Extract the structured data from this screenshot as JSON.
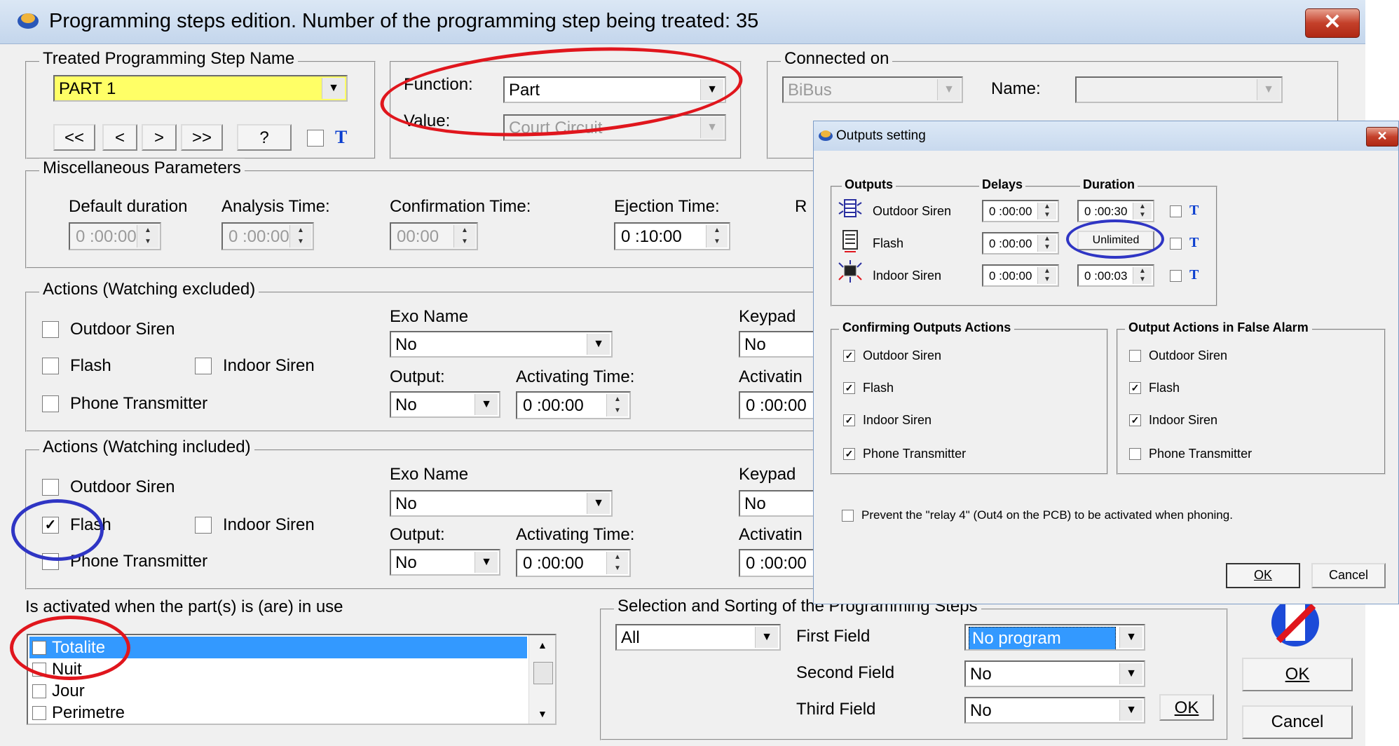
{
  "window": {
    "title": "Programming steps edition.  Number of the programming step being treated: 35",
    "close_label": "✕"
  },
  "step_name_group": {
    "legend": "Treated Programming Step Name",
    "name_value": "PART 1",
    "nav_first": "<<",
    "nav_prev": "<",
    "nav_next": ">",
    "nav_last": ">>",
    "help": "?",
    "t_label": "T"
  },
  "function_group": {
    "function_label": "Function:",
    "function_value": "Part",
    "value_label": "Value:",
    "value_value": "Court Circuit"
  },
  "connected_group": {
    "legend": "Connected on",
    "bus_value": "BiBus",
    "name_label": "Name:",
    "name_value": ""
  },
  "misc_group": {
    "legend": "Miscellaneous Parameters",
    "default_duration_label": "Default duration",
    "default_duration_value": "0 :00:00",
    "analysis_time_label": "Analysis Time:",
    "analysis_time_value": "0 :00:00",
    "confirmation_time_label": "Confirmation Time:",
    "confirmation_time_value": "00:00",
    "ejection_time_label": "Ejection Time:",
    "ejection_time_value": "0 :10:00",
    "cut_label": "R"
  },
  "actions_excluded": {
    "legend": "Actions (Watching excluded)",
    "outdoor_siren": "Outdoor Siren",
    "flash": "Flash",
    "indoor_siren": "Indoor Siren",
    "phone_transmitter": "Phone Transmitter",
    "exo_name_label": "Exo Name",
    "exo_name_value": "No",
    "output_label": "Output:",
    "output_value": "No",
    "activating_time_label": "Activating Time:",
    "activating_time_value": "0 :00:00",
    "keypad_label": "Keypad",
    "keypad_value": "No",
    "activating_cut_label": "Activatin",
    "activating_cut_value": "0 :00:00"
  },
  "actions_included": {
    "legend": "Actions (Watching included)",
    "outdoor_siren": "Outdoor Siren",
    "flash": "Flash",
    "indoor_siren": "Indoor Siren",
    "phone_transmitter": "Phone Transmitter",
    "exo_name_label": "Exo Name",
    "exo_name_value": "No",
    "output_label": "Output:",
    "output_value": "No",
    "activating_time_label": "Activating Time:",
    "activating_time_value": "0 :00:00",
    "keypad_label": "Keypad",
    "keypad_value": "No",
    "activating_cut_label": "Activatin",
    "activating_cut_value": "0 :00:00"
  },
  "parts": {
    "label": "Is activated when the part(s) is (are) in use",
    "items": [
      "Totalite",
      "Nuit",
      "Jour",
      "Perimetre"
    ]
  },
  "sorting_group": {
    "legend": "Selection and Sorting of the Programming Steps",
    "all_value": "All",
    "first_field_label": "First Field",
    "first_field_value": "No program",
    "second_field_label": "Second Field",
    "second_field_value": "No",
    "third_field_label": "Third Field",
    "third_field_value": "No",
    "ok_label": "OK"
  },
  "main_buttons": {
    "ok_label": "OK",
    "cancel_label": "Cancel"
  },
  "outputs_dialog": {
    "title": "Outputs setting",
    "close_label": "✕",
    "col_outputs": "Outputs",
    "col_delays": "Delays",
    "col_duration": "Duration",
    "rows": [
      {
        "name": "Outdoor Siren",
        "delay": "0 :00:00",
        "duration": "0 :00:30"
      },
      {
        "name": "Flash",
        "delay": "0 :00:00",
        "duration": "Unlimited"
      },
      {
        "name": "Indoor Siren",
        "delay": "0 :00:00",
        "duration": "0 :00:03"
      }
    ],
    "t_label": "T",
    "confirming_legend": "Confirming Outputs Actions",
    "false_alarm_legend": "Output Actions in False Alarm",
    "action_items": [
      "Outdoor Siren",
      "Flash",
      "Indoor Siren",
      "Phone Transmitter"
    ],
    "prevent_label": "Prevent the \"relay 4\" (Out4 on the PCB) to be activated when phoning.",
    "ok_label": "OK",
    "cancel_label": "Cancel"
  },
  "colors": {
    "highlight_yellow": "#ffff66",
    "selection_blue": "#3399ff",
    "annotation_red": "#e0161d",
    "annotation_blue": "#2f35c4",
    "t_blue": "#0a3ecf"
  }
}
